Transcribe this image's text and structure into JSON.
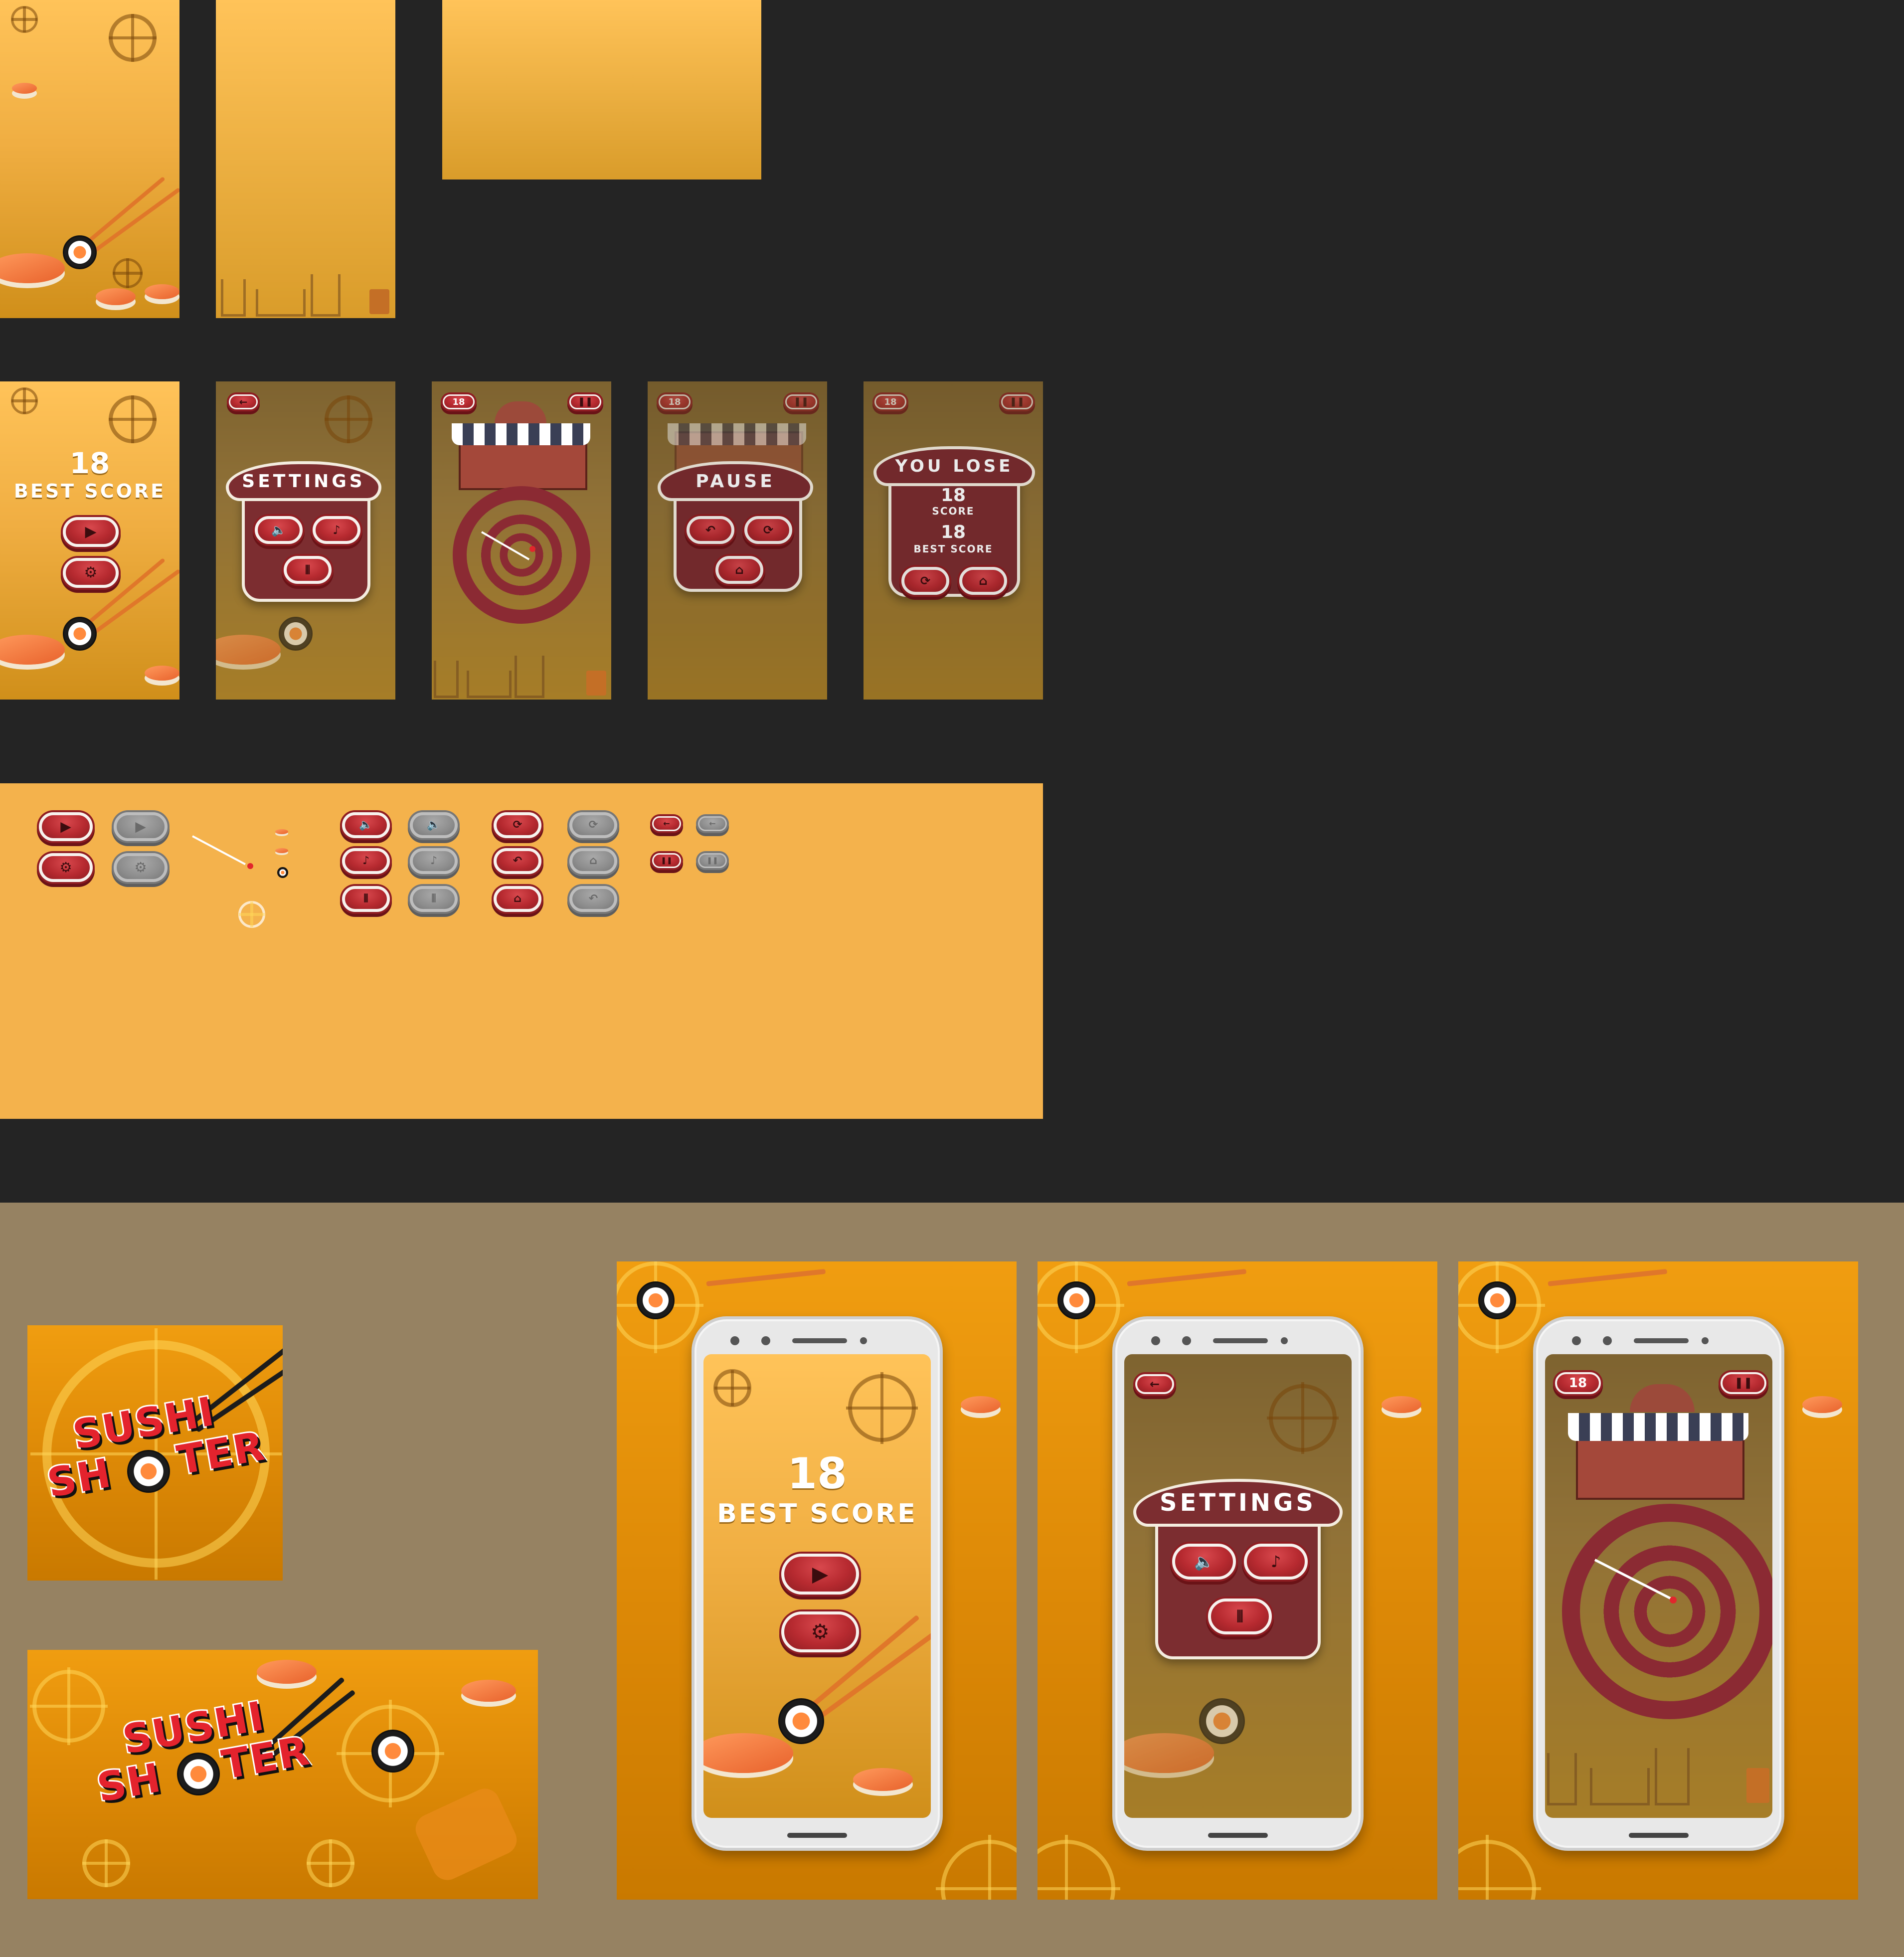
{
  "colors": {
    "canvas_dark": "#242424",
    "canvas_tan": "#968262",
    "button_red": "#b72a30",
    "panel_maroon": "#7c2d30",
    "sheet_orange": "#f4b24c"
  },
  "menu": {
    "score": "18",
    "best_score_label": "BEST SCORE",
    "play_icon": "play-icon",
    "settings_icon": "gear-icon"
  },
  "settings": {
    "title": "SETTINGS",
    "buttons": [
      "sound-icon",
      "music-icon",
      "vibration-icon"
    ],
    "back_icon": "back-arrow-icon"
  },
  "game": {
    "score": "18",
    "pause_icon": "pause-icon"
  },
  "pause": {
    "score": "18",
    "title": "PAUSE",
    "buttons": [
      "undo-icon",
      "restart-icon",
      "home-icon"
    ]
  },
  "lose": {
    "badge": "18",
    "title": "YOU LOSE",
    "score": "18",
    "score_label": "SCORE",
    "best": "18",
    "best_label": "BEST SCORE",
    "buttons": [
      "restart-icon",
      "home-icon"
    ]
  },
  "logo": {
    "line1": "SUSHI",
    "line2_a": "SH",
    "line2_b": "TER"
  },
  "promo": {
    "menu_score": "18",
    "menu_label": "BEST SCORE",
    "settings_title": "SETTINGS",
    "game_score": "18"
  }
}
